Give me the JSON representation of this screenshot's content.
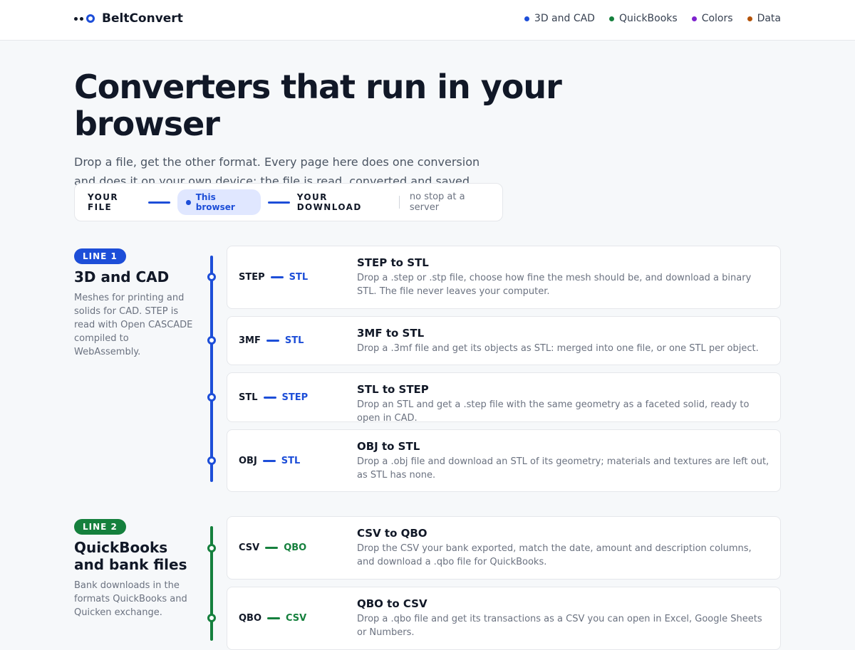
{
  "brand": {
    "name": "BeltConvert"
  },
  "nav": [
    {
      "label": "3D and CAD",
      "color": "#1d4ed8"
    },
    {
      "label": "QuickBooks",
      "color": "#15803d"
    },
    {
      "label": "Colors",
      "color": "#7e22ce"
    },
    {
      "label": "Data",
      "color": "#b45309"
    }
  ],
  "hero": {
    "title": "Converters that run in your browser",
    "subtitle": "Drop a file, get the other format. Every page here does one conversion and does it on your own device: the file is read, converted and saved without ever leaving your computer. No accounts, no queue, no upload."
  },
  "flow": {
    "from": "YOUR FILE",
    "middle": "This browser",
    "to": "YOUR DOWNLOAD",
    "note": "no stop at a server"
  },
  "sections": [
    {
      "badge": "LINE 1",
      "title": "3D and CAD",
      "desc": "Meshes for printing and solids for CAD. STEP is read with Open CASCADE compiled to WebAssembly.",
      "color": "#1d4ed8",
      "cards": [
        {
          "from": "STEP",
          "to": "STL",
          "title": "STEP to STL",
          "desc": "Drop a .step or .stp file, choose how fine the mesh should be, and download a binary STL. The file never leaves your computer."
        },
        {
          "from": "3MF",
          "to": "STL",
          "title": "3MF to STL",
          "desc": "Drop a .3mf file and get its objects as STL: merged into one file, or one STL per object."
        },
        {
          "from": "STL",
          "to": "STEP",
          "title": "STL to STEP",
          "desc": "Drop an STL and get a .step file with the same geometry as a faceted solid, ready to open in CAD."
        },
        {
          "from": "OBJ",
          "to": "STL",
          "title": "OBJ to STL",
          "desc": "Drop a .obj file and download an STL of its geometry; materials and textures are left out, as STL has none."
        }
      ]
    },
    {
      "badge": "LINE 2",
      "title": "QuickBooks and bank files",
      "desc": "Bank downloads in the formats QuickBooks and Quicken exchange.",
      "color": "#15803d",
      "cards": [
        {
          "from": "CSV",
          "to": "QBO",
          "title": "CSV to QBO",
          "desc": "Drop the CSV your bank exported, match the date, amount and description columns, and download a .qbo file for QuickBooks."
        },
        {
          "from": "QBO",
          "to": "CSV",
          "title": "QBO to CSV",
          "desc": "Drop a .qbo file and get its transactions as a CSV you can open in Excel, Google Sheets or Numbers."
        }
      ]
    }
  ]
}
